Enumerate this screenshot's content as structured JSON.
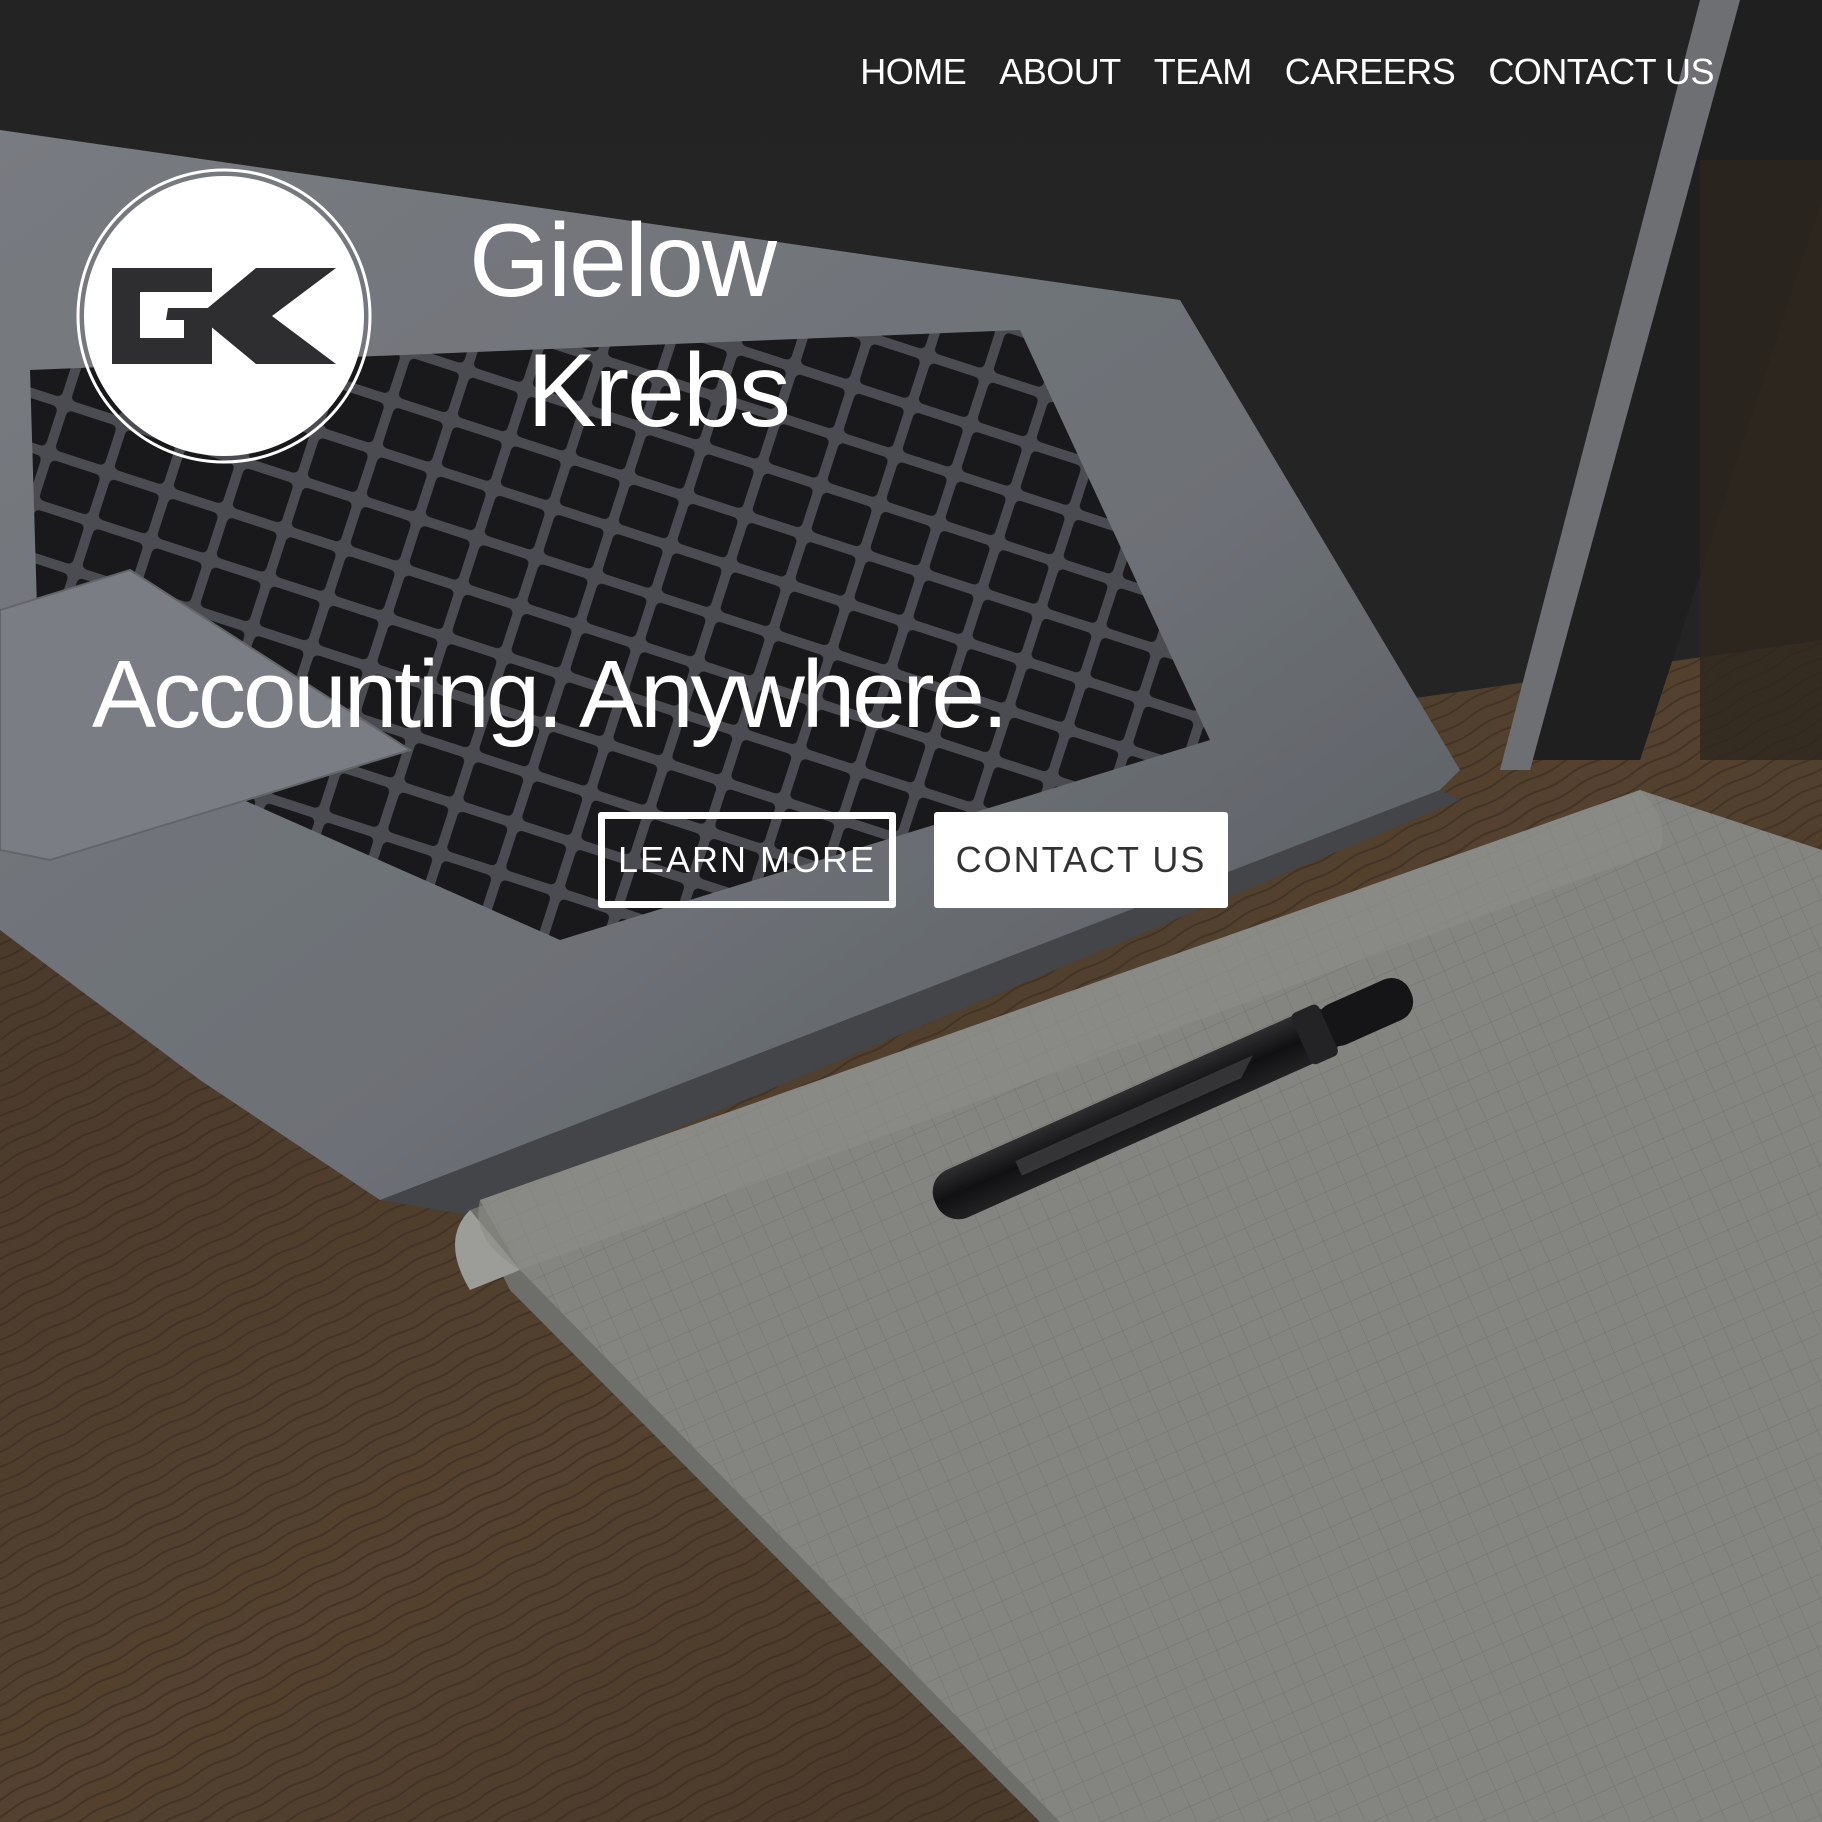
{
  "nav": {
    "items": [
      {
        "label": "HOME"
      },
      {
        "label": "ABOUT"
      },
      {
        "label": "TEAM"
      },
      {
        "label": "CAREERS"
      },
      {
        "label": "CONTACT US"
      }
    ]
  },
  "brand": {
    "name_line1": "Gielow",
    "name_line2": "Krebs",
    "logo_letters": "GK",
    "logo_icon": "gk-monogram-icon"
  },
  "hero": {
    "headline": "Accounting. Anywhere.",
    "buttons": {
      "learn_more": "LEARN MORE",
      "contact_us": "CONTACT US"
    }
  },
  "colors": {
    "text": "#ffffff",
    "solid_button_bg": "#ffffff",
    "solid_button_text": "#333333",
    "background_dark": "#2b2b2b"
  }
}
